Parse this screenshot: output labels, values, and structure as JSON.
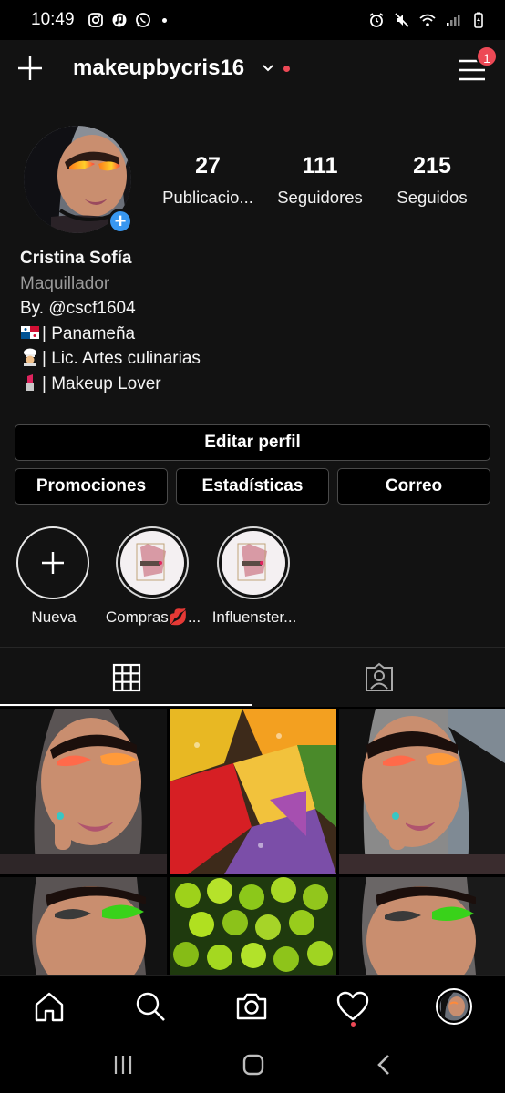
{
  "status_bar": {
    "time": "10:49"
  },
  "header": {
    "username": "makeupbycris16",
    "menu_badge": "1",
    "accent": "#ed4956"
  },
  "stats": [
    {
      "value": "27",
      "label": "Publicacio..."
    },
    {
      "value": "111",
      "label": "Seguidores"
    },
    {
      "value": "215",
      "label": "Seguidos"
    }
  ],
  "bio": {
    "name": "Cristina Sofía",
    "category": "Maquillador",
    "lines": [
      "By. @cscf1604",
      "| Panameña",
      "| Lic. Artes culinarias",
      "| Makeup Lover"
    ],
    "emoji_icons": [
      "panama-flag-icon",
      "chef-icon",
      "lipstick-icon"
    ]
  },
  "buttons": {
    "edit_profile": "Editar perfil",
    "promotions": "Promociones",
    "insights": "Estadísticas",
    "email": "Correo"
  },
  "highlights": [
    {
      "label": "Nueva"
    },
    {
      "label": "Compras💋..."
    },
    {
      "label": "Influenster..."
    }
  ],
  "tabs": [
    {
      "icon": "grid-icon",
      "active": true
    },
    {
      "icon": "tagged-person-icon",
      "active": false
    }
  ],
  "bottom_nav": [
    "home-icon",
    "search-icon",
    "camera-icon",
    "heart-icon",
    "profile-avatar"
  ],
  "colors": {
    "accent_blue": "#3897f0",
    "notification_red": "#ed4956",
    "background": "#121212"
  }
}
